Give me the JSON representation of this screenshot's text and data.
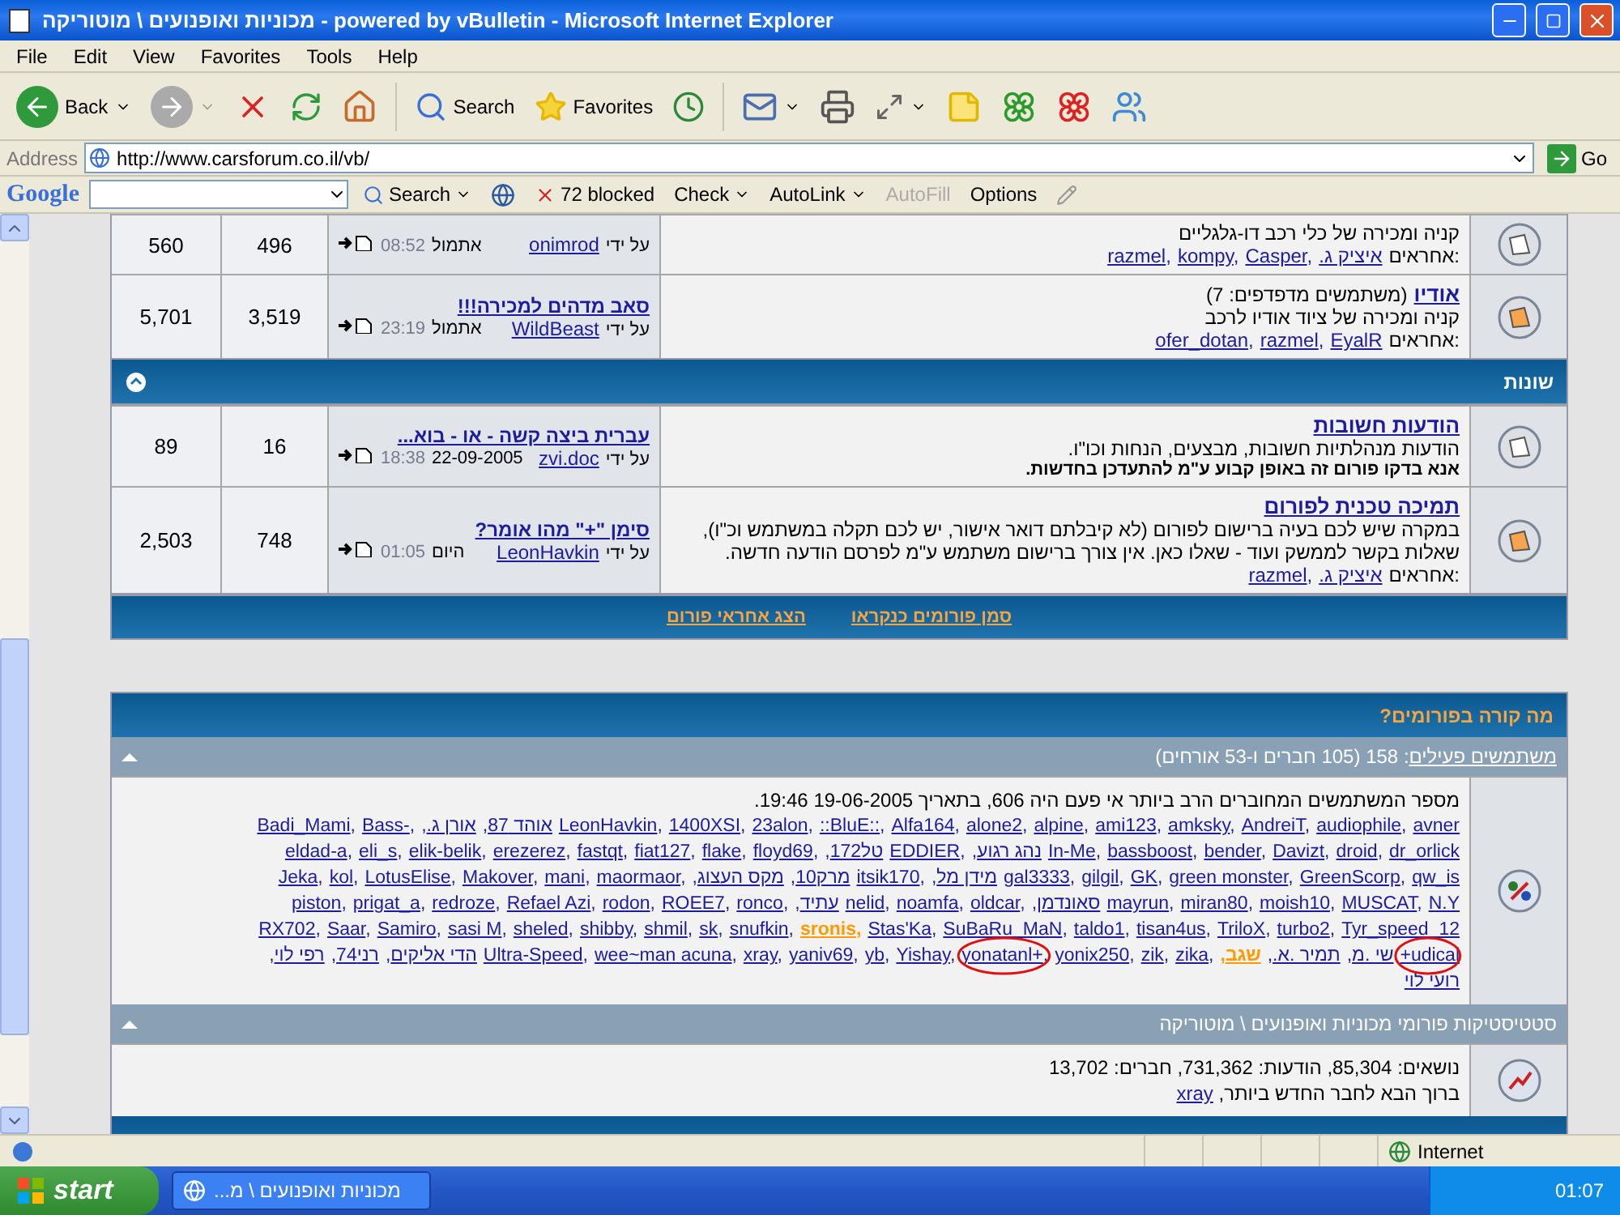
{
  "window": {
    "title": "מכוניות ואופנועים \\ מוטוריקה - powered by vBulletin - Microsoft Internet Explorer"
  },
  "menu": [
    "File",
    "Edit",
    "View",
    "Favorites",
    "Tools",
    "Help"
  ],
  "toolbar": {
    "back": "Back",
    "search": "Search",
    "favorites": "Favorites"
  },
  "address": {
    "label": "Address",
    "value": "http://www.carsforum.co.il/vb/",
    "go": "Go"
  },
  "google_bar": {
    "logo": "Google",
    "search": "Search",
    "blocked": "72 blocked",
    "check": "Check",
    "autolink": "AutoLink",
    "autofill": {
      "label": "AutoFill",
      "disabled": true
    },
    "options": "Options"
  },
  "list_separator": ",",
  "forum_rows": [
    {
      "kind": "forum",
      "new_posts": false,
      "description": "קניה ומכירה של כלי רכב דו-גלגליים",
      "moderators_label": "אחראים:",
      "moderators": [
        "razmel",
        "kompy",
        "Casper",
        "איציק ג."
      ],
      "last_post": {
        "by_label": "על ידי",
        "user": "onimrod",
        "day": "אתמול",
        "time": "08:52"
      },
      "threads": "496",
      "posts": "560"
    },
    {
      "kind": "forum",
      "new_posts": true,
      "title": "אודיו",
      "viewers": "(משתמשים מדפדפים: 7)",
      "description": "קניה ומכירה של ציוד אודיו לרכב",
      "moderators_label": "אחראים:",
      "moderators": [
        "ofer_dotan",
        "razmel",
        "EyalR"
      ],
      "last_post": {
        "title": "סאב מדהים למכירה!!!",
        "by_label": "על ידי",
        "user": "WildBeast",
        "day": "אתמול",
        "time": "23:19"
      },
      "threads": "3,519",
      "posts": "5,701"
    },
    {
      "kind": "category",
      "title": "שונות"
    },
    {
      "kind": "forum",
      "new_posts": false,
      "title": "הודעות חשובות",
      "description": "הודעות מנהלתיות חשובות, מבצעים, הנחות וכו\"ו.",
      "notice": "אנא בדקו פורום זה באופן קבוע ע\"מ להתעדכן בחדשות.",
      "last_post": {
        "title": "עברית ביצה קשה - או - בוא...",
        "by_label": "על ידי",
        "user": "zvi.doc",
        "day": "22-09-2005",
        "time": "18:38"
      },
      "threads": "16",
      "posts": "89"
    },
    {
      "kind": "forum",
      "new_posts": true,
      "title": "תמיכה טכנית לפורום",
      "description": "במקרה שיש לכם בעיה ברישום לפורום (לא קיבלתם דואר אישור, יש לכם תקלה במשתמש וכ\"ו), שאלות בקשר לממשק ועוד - שאלו כאן. אין צורך ברישום משתמש ע\"מ לפרסם הודעה חדשה.",
      "moderators_label": "אחראים:",
      "moderators": [
        "razmel",
        "איציק ג."
      ],
      "last_post": {
        "title": "סימן \"+\" מהו אומר?",
        "by_label": "על ידי",
        "user": "LeonHavkin",
        "day": "היום",
        "time": "01:05"
      },
      "threads": "748",
      "posts": "2,503"
    }
  ],
  "forum_footer": [
    "סמן פורומים כנקראו",
    "הצג אחראי פורום"
  ],
  "whats_going_on": {
    "title": "מה קורה בפורומים?",
    "active_header_link": "משתמשים פעילים",
    "active_header_rest": ": 158 (105 חברים ו-53 אורחים)",
    "record": "מספר המשתמשים המחוברים הרב ביותר אי פעם היה 606, בתאריך 19-06-2005 19:46.",
    "user_lines": [
      [
        {
          "name": "Badi_Mami",
          "kind": "member",
          "circled": false
        },
        {
          "name": "Bass-",
          "kind": "member",
          "circled": false
        },
        {
          "name": "אורן ג.",
          "kind": "member",
          "circled": false
        },
        {
          "name": "אוהד 87",
          "kind": "member",
          "circled": false
        },
        {
          "name": "LeonHavkin",
          "kind": "member",
          "circled": false
        },
        {
          "name": "1400XSI",
          "kind": "member",
          "circled": false
        },
        {
          "name": "23alon",
          "kind": "member",
          "circled": false
        },
        {
          "name": "::BluE::",
          "kind": "member",
          "circled": false
        },
        {
          "name": "Alfa164",
          "kind": "member",
          "circled": false
        },
        {
          "name": "alone2",
          "kind": "member",
          "circled": false
        },
        {
          "name": "alpine",
          "kind": "member",
          "circled": false
        },
        {
          "name": "ami123",
          "kind": "member",
          "circled": false
        },
        {
          "name": "amksky",
          "kind": "member",
          "circled": false
        },
        {
          "name": "AndreiT",
          "kind": "member",
          "circled": false
        },
        {
          "name": "audiophile",
          "kind": "member",
          "circled": false
        },
        {
          "name": "avner",
          "kind": "member",
          "circled": false
        }
      ],
      [
        {
          "name": "eldad-a",
          "kind": "member",
          "circled": false
        },
        {
          "name": "eli_s",
          "kind": "member",
          "circled": false
        },
        {
          "name": "elik-belik",
          "kind": "member",
          "circled": false
        },
        {
          "name": "erezerez",
          "kind": "member",
          "circled": false
        },
        {
          "name": "fastqt",
          "kind": "member",
          "circled": false
        },
        {
          "name": "fiat127",
          "kind": "member",
          "circled": false
        },
        {
          "name": "flake",
          "kind": "member",
          "circled": false
        },
        {
          "name": "floyd69",
          "kind": "member",
          "circled": false
        },
        {
          "name": "טל172",
          "kind": "member",
          "circled": false
        },
        {
          "name": "EDDIER",
          "kind": "member",
          "circled": false
        },
        {
          "name": "נהג רגוע",
          "kind": "member",
          "circled": false
        },
        {
          "name": "In-Me",
          "kind": "member",
          "circled": false
        },
        {
          "name": "bassboost",
          "kind": "member",
          "circled": false
        },
        {
          "name": "bender",
          "kind": "member",
          "circled": false
        },
        {
          "name": "Davizt",
          "kind": "member",
          "circled": false
        },
        {
          "name": "droid",
          "kind": "member",
          "circled": false
        },
        {
          "name": "dr_orlick",
          "kind": "member",
          "circled": false
        }
      ],
      [
        {
          "name": "Jeka",
          "kind": "member",
          "circled": false
        },
        {
          "name": "kol",
          "kind": "member",
          "circled": false
        },
        {
          "name": "LotusElise",
          "kind": "member",
          "circled": false
        },
        {
          "name": "Makover",
          "kind": "member",
          "circled": false
        },
        {
          "name": "mani",
          "kind": "member",
          "circled": false
        },
        {
          "name": "maormaor",
          "kind": "member",
          "circled": false
        },
        {
          "name": "מקס העצוג",
          "kind": "member",
          "circled": false
        },
        {
          "name": "מרק10",
          "kind": "member",
          "circled": false
        },
        {
          "name": "itsik170",
          "kind": "member",
          "circled": false
        },
        {
          "name": "מידן מל",
          "kind": "member",
          "circled": false
        },
        {
          "name": "gal3333",
          "kind": "member",
          "circled": false
        },
        {
          "name": "gilgil",
          "kind": "member",
          "circled": false
        },
        {
          "name": "GK",
          "kind": "member",
          "circled": false
        },
        {
          "name": "green monster",
          "kind": "member",
          "circled": false
        },
        {
          "name": "GreenScorp",
          "kind": "member",
          "circled": false
        },
        {
          "name": "qw_is",
          "kind": "member",
          "circled": false
        }
      ],
      [
        {
          "name": "piston",
          "kind": "member",
          "circled": false
        },
        {
          "name": "prigat_a",
          "kind": "member",
          "circled": false
        },
        {
          "name": "redroze",
          "kind": "member",
          "circled": false
        },
        {
          "name": "Refael Azi",
          "kind": "member",
          "circled": false
        },
        {
          "name": "rodon",
          "kind": "member",
          "circled": false
        },
        {
          "name": "ROEE7",
          "kind": "member",
          "circled": false
        },
        {
          "name": "ronco",
          "kind": "member",
          "circled": false
        },
        {
          "name": "עתיד",
          "kind": "member",
          "circled": false
        },
        {
          "name": "nelid",
          "kind": "member",
          "circled": false
        },
        {
          "name": "noamfa",
          "kind": "member",
          "circled": false
        },
        {
          "name": "oldcar",
          "kind": "member",
          "circled": false
        },
        {
          "name": "סאונדמן",
          "kind": "member",
          "circled": false
        },
        {
          "name": "mayrun",
          "kind": "member",
          "circled": false
        },
        {
          "name": "miran80",
          "kind": "member",
          "circled": false
        },
        {
          "name": "moish10",
          "kind": "member",
          "circled": false
        },
        {
          "name": "MUSCAT",
          "kind": "member",
          "circled": false
        },
        {
          "name": "N.Y",
          "kind": "member",
          "circled": false
        }
      ],
      [
        {
          "name": "RX702",
          "kind": "member",
          "circled": false
        },
        {
          "name": "Saar",
          "kind": "member",
          "circled": false
        },
        {
          "name": "Samiro",
          "kind": "member",
          "circled": false
        },
        {
          "name": "sasi M",
          "kind": "member",
          "circled": false
        },
        {
          "name": "sheled",
          "kind": "member",
          "circled": false
        },
        {
          "name": "shibby",
          "kind": "member",
          "circled": false
        },
        {
          "name": "shmil",
          "kind": "member",
          "circled": false
        },
        {
          "name": "sk",
          "kind": "member",
          "circled": false
        },
        {
          "name": "snufkin",
          "kind": "member",
          "circled": false
        },
        {
          "name": "sronis",
          "kind": "staff",
          "circled": false
        },
        {
          "name": "Stas'Ka",
          "kind": "member",
          "circled": false
        },
        {
          "name": "SuBaRu_MaN",
          "kind": "member",
          "circled": false
        },
        {
          "name": "taldo1",
          "kind": "member",
          "circled": false
        },
        {
          "name": "tisan4us",
          "kind": "member",
          "circled": false
        },
        {
          "name": "TriloX",
          "kind": "member",
          "circled": false
        },
        {
          "name": "turbo2",
          "kind": "member",
          "circled": false
        },
        {
          "name": "Tyr_speed_12",
          "kind": "member",
          "circled": false
        }
      ],
      [
        {
          "name": "רפי לוי",
          "kind": "member",
          "circled": false
        },
        {
          "name": "רני74",
          "kind": "member",
          "circled": false
        },
        {
          "name": "הדי אליקים",
          "kind": "member",
          "circled": false
        },
        {
          "name": "Ultra-Speed",
          "kind": "member",
          "circled": false
        },
        {
          "name": "wee~man acuna",
          "kind": "member",
          "circled": false
        },
        {
          "name": "xray",
          "kind": "member",
          "circled": false
        },
        {
          "name": "yaniv69",
          "kind": "member",
          "circled": false
        },
        {
          "name": "yb",
          "kind": "member",
          "circled": false
        },
        {
          "name": "Yishay",
          "kind": "member",
          "circled": false
        },
        {
          "name": "yonatanl+",
          "kind": "member",
          "circled": true
        },
        {
          "name": "yonix250",
          "kind": "member",
          "circled": false
        },
        {
          "name": "zik",
          "kind": "member",
          "circled": false
        },
        {
          "name": "zika",
          "kind": "member",
          "circled": false
        },
        {
          "name": "שגב",
          "kind": "staff",
          "circled": false
        },
        {
          "name": "תמיר .א.",
          "kind": "member",
          "circled": false
        },
        {
          "name": "שי .מ",
          "kind": "member",
          "circled": false
        },
        {
          "name": "+udical",
          "kind": "member",
          "circled": true
        }
      ],
      [
        {
          "name": "רועי לוי",
          "kind": "member",
          "circled": false
        }
      ]
    ],
    "stats_title": "סטטיסטיקות פורומי מכוניות ואופנועים \\ מוטוריקה",
    "stats_line": "נושאים: 85,304, הודעות: 731,362, חברים: 13,702",
    "welcome": "ברוך הבא לחבר החדש ביותר, ",
    "newest_member": "xray"
  },
  "status_bar": {
    "zone": "Internet"
  },
  "taskbar": {
    "start": "start",
    "task": "מכוניות ואופנועים \\ מ...",
    "clock": "01:07"
  }
}
